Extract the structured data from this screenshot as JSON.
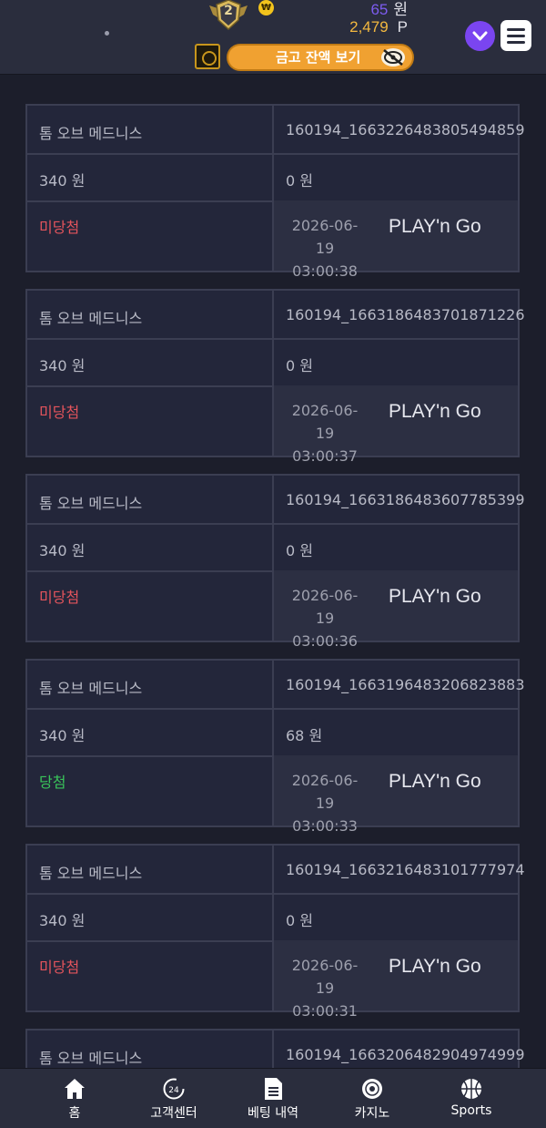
{
  "header": {
    "level": "2",
    "won_symbol": "₩",
    "balance_amount": "65",
    "balance_unit": "원",
    "points_amount": "2,479",
    "points_unit": "P",
    "vault_button_label": "금고 잔액 보기",
    "colors": {
      "accent_purple": "#7a45f0",
      "vault_orange": "#f0a131",
      "points_gold": "#f3b83f"
    }
  },
  "bets": [
    {
      "game": "톰 오브 메드니스",
      "bet_id": "160194_1663226483805494859",
      "bet_amount": "340 원",
      "win_amount": "0 원",
      "status": "미당첨",
      "status_type": "lose",
      "date": "2026-06-19",
      "time": "03:00:38",
      "provider": "PLAY'n Go"
    },
    {
      "game": "톰 오브 메드니스",
      "bet_id": "160194_1663186483701871226",
      "bet_amount": "340 원",
      "win_amount": "0 원",
      "status": "미당첨",
      "status_type": "lose",
      "date": "2026-06-19",
      "time": "03:00:37",
      "provider": "PLAY'n Go"
    },
    {
      "game": "톰 오브 메드니스",
      "bet_id": "160194_1663186483607785399",
      "bet_amount": "340 원",
      "win_amount": "0 원",
      "status": "미당첨",
      "status_type": "lose",
      "date": "2026-06-19",
      "time": "03:00:36",
      "provider": "PLAY'n Go"
    },
    {
      "game": "톰 오브 메드니스",
      "bet_id": "160194_1663196483206823883",
      "bet_amount": "340 원",
      "win_amount": "68 원",
      "status": "당첨",
      "status_type": "win",
      "date": "2026-06-19",
      "time": "03:00:33",
      "provider": "PLAY'n Go"
    },
    {
      "game": "톰 오브 메드니스",
      "bet_id": "160194_1663216483101777974",
      "bet_amount": "340 원",
      "win_amount": "0 원",
      "status": "미당첨",
      "status_type": "lose",
      "date": "2026-06-19",
      "time": "03:00:31",
      "provider": "PLAY'n Go"
    },
    {
      "game": "톰 오브 메드니스",
      "bet_id": "160194_1663206482904974999",
      "bet_amount": "",
      "win_amount": "",
      "status": "",
      "status_type": "lose",
      "date": "",
      "time": "",
      "provider": ""
    }
  ],
  "bottom_nav": [
    {
      "label": "홈",
      "icon": "home-icon"
    },
    {
      "label": "고객센터",
      "icon": "support-24-icon"
    },
    {
      "label": "베팅 내역",
      "icon": "document-icon"
    },
    {
      "label": "카지노",
      "icon": "roulette-icon"
    },
    {
      "label": "Sports",
      "icon": "basketball-icon"
    }
  ]
}
